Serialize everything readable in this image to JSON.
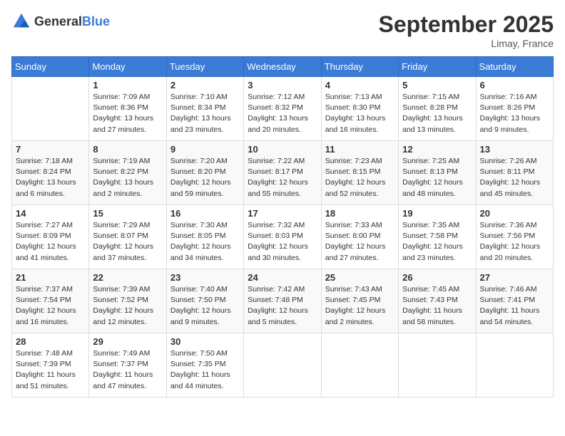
{
  "header": {
    "logo": {
      "text_general": "General",
      "text_blue": "Blue"
    },
    "month_title": "September 2025",
    "location": "Limay, France"
  },
  "days_of_week": [
    "Sunday",
    "Monday",
    "Tuesday",
    "Wednesday",
    "Thursday",
    "Friday",
    "Saturday"
  ],
  "weeks": [
    [
      {
        "day": "",
        "info": ""
      },
      {
        "day": "1",
        "info": "Sunrise: 7:09 AM\nSunset: 8:36 PM\nDaylight: 13 hours\nand 27 minutes."
      },
      {
        "day": "2",
        "info": "Sunrise: 7:10 AM\nSunset: 8:34 PM\nDaylight: 13 hours\nand 23 minutes."
      },
      {
        "day": "3",
        "info": "Sunrise: 7:12 AM\nSunset: 8:32 PM\nDaylight: 13 hours\nand 20 minutes."
      },
      {
        "day": "4",
        "info": "Sunrise: 7:13 AM\nSunset: 8:30 PM\nDaylight: 13 hours\nand 16 minutes."
      },
      {
        "day": "5",
        "info": "Sunrise: 7:15 AM\nSunset: 8:28 PM\nDaylight: 13 hours\nand 13 minutes."
      },
      {
        "day": "6",
        "info": "Sunrise: 7:16 AM\nSunset: 8:26 PM\nDaylight: 13 hours\nand 9 minutes."
      }
    ],
    [
      {
        "day": "7",
        "info": "Sunrise: 7:18 AM\nSunset: 8:24 PM\nDaylight: 13 hours\nand 6 minutes."
      },
      {
        "day": "8",
        "info": "Sunrise: 7:19 AM\nSunset: 8:22 PM\nDaylight: 13 hours\nand 2 minutes."
      },
      {
        "day": "9",
        "info": "Sunrise: 7:20 AM\nSunset: 8:20 PM\nDaylight: 12 hours\nand 59 minutes."
      },
      {
        "day": "10",
        "info": "Sunrise: 7:22 AM\nSunset: 8:17 PM\nDaylight: 12 hours\nand 55 minutes."
      },
      {
        "day": "11",
        "info": "Sunrise: 7:23 AM\nSunset: 8:15 PM\nDaylight: 12 hours\nand 52 minutes."
      },
      {
        "day": "12",
        "info": "Sunrise: 7:25 AM\nSunset: 8:13 PM\nDaylight: 12 hours\nand 48 minutes."
      },
      {
        "day": "13",
        "info": "Sunrise: 7:26 AM\nSunset: 8:11 PM\nDaylight: 12 hours\nand 45 minutes."
      }
    ],
    [
      {
        "day": "14",
        "info": "Sunrise: 7:27 AM\nSunset: 8:09 PM\nDaylight: 12 hours\nand 41 minutes."
      },
      {
        "day": "15",
        "info": "Sunrise: 7:29 AM\nSunset: 8:07 PM\nDaylight: 12 hours\nand 37 minutes."
      },
      {
        "day": "16",
        "info": "Sunrise: 7:30 AM\nSunset: 8:05 PM\nDaylight: 12 hours\nand 34 minutes."
      },
      {
        "day": "17",
        "info": "Sunrise: 7:32 AM\nSunset: 8:03 PM\nDaylight: 12 hours\nand 30 minutes."
      },
      {
        "day": "18",
        "info": "Sunrise: 7:33 AM\nSunset: 8:00 PM\nDaylight: 12 hours\nand 27 minutes."
      },
      {
        "day": "19",
        "info": "Sunrise: 7:35 AM\nSunset: 7:58 PM\nDaylight: 12 hours\nand 23 minutes."
      },
      {
        "day": "20",
        "info": "Sunrise: 7:36 AM\nSunset: 7:56 PM\nDaylight: 12 hours\nand 20 minutes."
      }
    ],
    [
      {
        "day": "21",
        "info": "Sunrise: 7:37 AM\nSunset: 7:54 PM\nDaylight: 12 hours\nand 16 minutes."
      },
      {
        "day": "22",
        "info": "Sunrise: 7:39 AM\nSunset: 7:52 PM\nDaylight: 12 hours\nand 12 minutes."
      },
      {
        "day": "23",
        "info": "Sunrise: 7:40 AM\nSunset: 7:50 PM\nDaylight: 12 hours\nand 9 minutes."
      },
      {
        "day": "24",
        "info": "Sunrise: 7:42 AM\nSunset: 7:48 PM\nDaylight: 12 hours\nand 5 minutes."
      },
      {
        "day": "25",
        "info": "Sunrise: 7:43 AM\nSunset: 7:45 PM\nDaylight: 12 hours\nand 2 minutes."
      },
      {
        "day": "26",
        "info": "Sunrise: 7:45 AM\nSunset: 7:43 PM\nDaylight: 11 hours\nand 58 minutes."
      },
      {
        "day": "27",
        "info": "Sunrise: 7:46 AM\nSunset: 7:41 PM\nDaylight: 11 hours\nand 54 minutes."
      }
    ],
    [
      {
        "day": "28",
        "info": "Sunrise: 7:48 AM\nSunset: 7:39 PM\nDaylight: 11 hours\nand 51 minutes."
      },
      {
        "day": "29",
        "info": "Sunrise: 7:49 AM\nSunset: 7:37 PM\nDaylight: 11 hours\nand 47 minutes."
      },
      {
        "day": "30",
        "info": "Sunrise: 7:50 AM\nSunset: 7:35 PM\nDaylight: 11 hours\nand 44 minutes."
      },
      {
        "day": "",
        "info": ""
      },
      {
        "day": "",
        "info": ""
      },
      {
        "day": "",
        "info": ""
      },
      {
        "day": "",
        "info": ""
      }
    ]
  ]
}
